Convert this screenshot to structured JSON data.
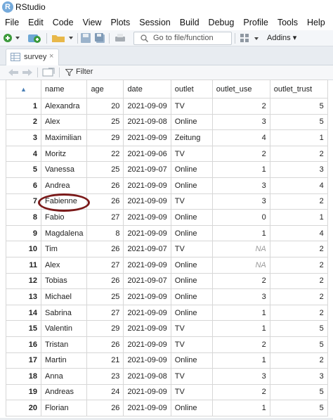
{
  "window": {
    "title": "RStudio",
    "app_icon": "R"
  },
  "menu": [
    "File",
    "Edit",
    "Code",
    "View",
    "Plots",
    "Session",
    "Build",
    "Debug",
    "Profile",
    "Tools",
    "Help"
  ],
  "toolbar": {
    "goto_placeholder": "Go to file/function",
    "addins_label": "Addins",
    "icons": [
      "new-file-icon",
      "open-project-icon",
      "open-folder-icon",
      "save-icon",
      "save-all-icon",
      "print-icon",
      "search-icon",
      "grid-layout-icon"
    ]
  },
  "tab": {
    "label": "survey",
    "close": "×"
  },
  "filter": {
    "label": "Filter"
  },
  "table": {
    "columns": [
      "name",
      "age",
      "date",
      "outlet",
      "outlet_use",
      "outlet_trust"
    ],
    "rows": [
      [
        "1",
        "Alexandra",
        "20",
        "2021-09-09",
        "TV",
        "2",
        "5"
      ],
      [
        "2",
        "Alex",
        "25",
        "2021-09-08",
        "Online",
        "3",
        "5"
      ],
      [
        "3",
        "Maximilian",
        "29",
        "2021-09-09",
        "Zeitung",
        "4",
        "1"
      ],
      [
        "4",
        "Moritz",
        "22",
        "2021-09-06",
        "TV",
        "2",
        "2"
      ],
      [
        "5",
        "Vanessa",
        "25",
        "2021-09-07",
        "Online",
        "1",
        "3"
      ],
      [
        "6",
        "Andrea",
        "26",
        "2021-09-09",
        "Online",
        "3",
        "4"
      ],
      [
        "7",
        "Fabienne",
        "26",
        "2021-09-09",
        "TV",
        "3",
        "2"
      ],
      [
        "8",
        "Fabio",
        "27",
        "2021-09-09",
        "Online",
        "0",
        "1"
      ],
      [
        "9",
        "Magdalena",
        "8",
        "2021-09-09",
        "Online",
        "1",
        "4"
      ],
      [
        "10",
        "Tim",
        "26",
        "2021-09-07",
        "TV",
        "NA",
        "2"
      ],
      [
        "11",
        "Alex",
        "27",
        "2021-09-09",
        "Online",
        "NA",
        "2"
      ],
      [
        "12",
        "Tobias",
        "26",
        "2021-09-07",
        "Online",
        "2",
        "2"
      ],
      [
        "13",
        "Michael",
        "25",
        "2021-09-09",
        "Online",
        "3",
        "2"
      ],
      [
        "14",
        "Sabrina",
        "27",
        "2021-09-09",
        "Online",
        "1",
        "2"
      ],
      [
        "15",
        "Valentin",
        "29",
        "2021-09-09",
        "TV",
        "1",
        "5"
      ],
      [
        "16",
        "Tristan",
        "26",
        "2021-09-09",
        "TV",
        "2",
        "5"
      ],
      [
        "17",
        "Martin",
        "21",
        "2021-09-09",
        "Online",
        "1",
        "2"
      ],
      [
        "18",
        "Anna",
        "23",
        "2021-09-08",
        "TV",
        "3",
        "3"
      ],
      [
        "19",
        "Andreas",
        "24",
        "2021-09-09",
        "TV",
        "2",
        "5"
      ],
      [
        "20",
        "Florian",
        "26",
        "2021-09-09",
        "Online",
        "1",
        "5"
      ]
    ]
  },
  "colors": {
    "highlight": "#7b1a1a",
    "r_blue": "#75aadb"
  }
}
